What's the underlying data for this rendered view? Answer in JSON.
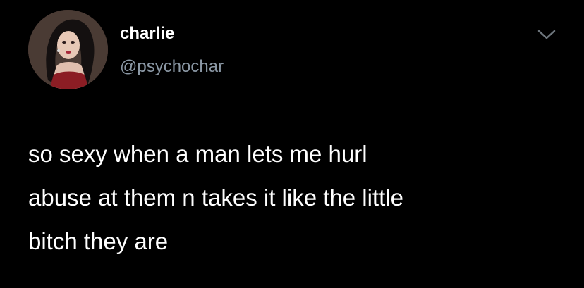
{
  "author": {
    "display_name": "charlie",
    "handle": "@psychochar",
    "avatar_icon": "avatar-image"
  },
  "menu": {
    "icon": "chevron-down-icon"
  },
  "tweet": {
    "lines": [
      "so sexy when a man lets me hurl",
      "abuse at them n takes it like the little",
      "bitch they are"
    ]
  },
  "colors": {
    "background": "#000000",
    "primary_text": "#ffffff",
    "secondary_text": "#8b98a5"
  }
}
